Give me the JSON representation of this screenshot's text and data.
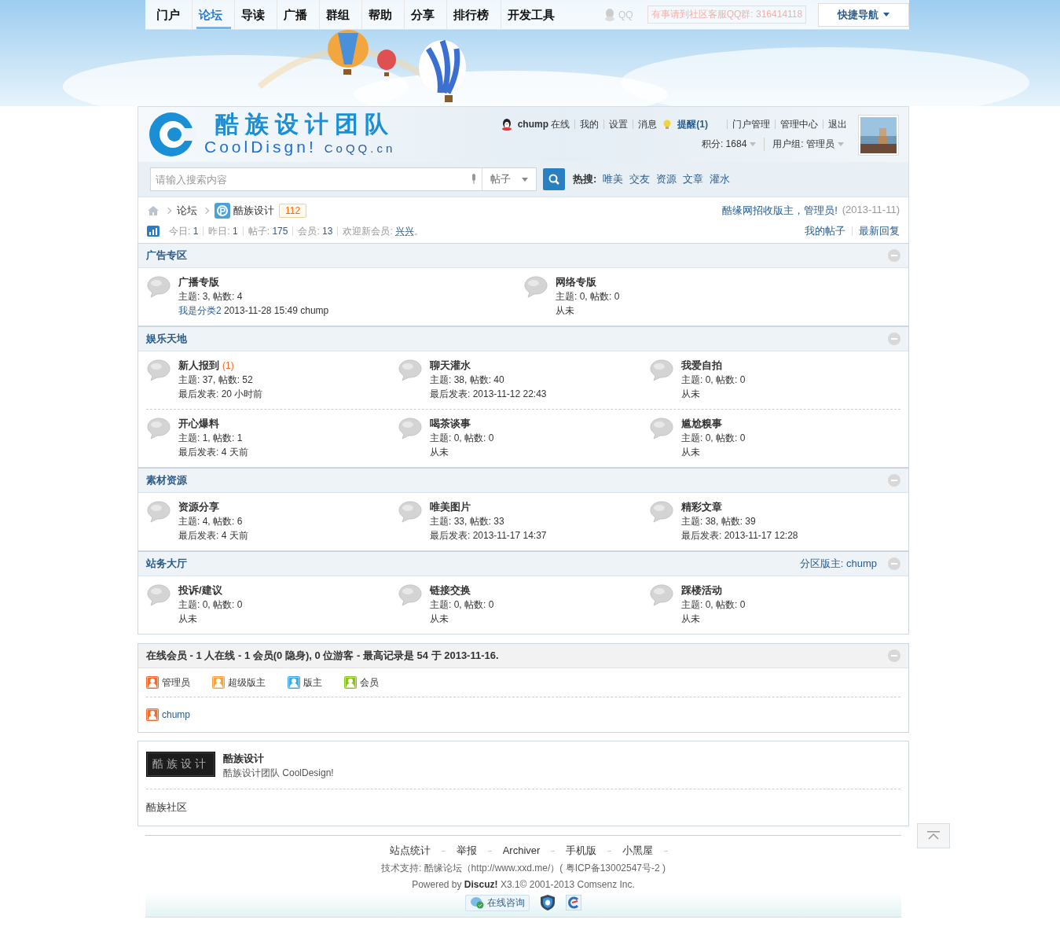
{
  "nav": {
    "items": [
      {
        "label": "门户",
        "selected": false
      },
      {
        "label": "论坛",
        "selected": true
      },
      {
        "label": "导读",
        "selected": false
      },
      {
        "label": "广播",
        "selected": false
      },
      {
        "label": "群组",
        "selected": false
      },
      {
        "label": "帮助",
        "selected": false
      },
      {
        "label": "分享",
        "selected": false
      },
      {
        "label": "排行榜",
        "selected": false
      },
      {
        "label": "开发工具",
        "selected": false
      }
    ],
    "qq": "QQ",
    "qq_group": "有事请到社区客服QQ群: 316414118",
    "quick_nav": "快捷导航"
  },
  "header": {
    "logo_title": "酷族设计团队",
    "logo_sub": "CoolDisgn!",
    "logo_site": "CoQQ.cn",
    "user": {
      "name": "chump",
      "status": "在线",
      "links": [
        "我的",
        "设置",
        "消息"
      ],
      "reminder": "提醒(1)",
      "admin_links": [
        "门户管理",
        "管理中心",
        "退出"
      ],
      "points": "积分: 1684",
      "group": "用户组: 管理员"
    }
  },
  "search": {
    "placeholder": "请输入搜索内容",
    "type": "帖子",
    "hot_label": "热搜:",
    "hot": [
      "唯美",
      "交友",
      "资源",
      "文章",
      "灌水"
    ]
  },
  "breadcrumb": {
    "items": [
      "论坛",
      "酷族设计"
    ],
    "count": "112",
    "notice": "酷缘网招收版主，管理员!",
    "notice_date": "(2013-11-11)"
  },
  "stats": {
    "items": [
      {
        "label": "今日:",
        "value": "1"
      },
      {
        "label": "昨日:",
        "value": "1"
      },
      {
        "label": "帖子:",
        "value": "175"
      },
      {
        "label": "会员:",
        "value": "13"
      }
    ],
    "welcome": "欢迎新会员:",
    "new_member": "兴兴",
    "welcome_end": "。",
    "links": [
      "我的帖子",
      "最新回复"
    ]
  },
  "categories": [
    {
      "title": "广告专区",
      "expanded": true,
      "forums": [
        {
          "name": "广播专版",
          "stats": "主题: 3, 帖数: 4",
          "last": {
            "thread": "我是分类2",
            "text": "2013-11-28 15:49 chump"
          }
        },
        {
          "name": "网络专版",
          "stats": "主题: 0, 帖数: 0",
          "last": {
            "text": "从未"
          }
        }
      ]
    },
    {
      "title": "娱乐天地",
      "expanded": true,
      "forums": [
        {
          "name": "新人报到",
          "today": "(1)",
          "stats": "主题: 37, 帖数: 52",
          "last": {
            "text": "最后发表: 20 小时前"
          }
        },
        {
          "name": "聊天灌水",
          "stats": "主题: 38, 帖数: 40",
          "last": {
            "text": "最后发表: 2013-11-12 22:43"
          }
        },
        {
          "name": "我爱自拍",
          "stats": "主题: 0, 帖数: 0",
          "last": {
            "text": "从未"
          }
        },
        {
          "name": "开心爆料",
          "stats": "主题: 1, 帖数: 1",
          "last": {
            "text": "最后发表: 4 天前"
          }
        },
        {
          "name": "喝茶谈事",
          "stats": "主题: 0, 帖数: 0",
          "last": {
            "text": "从未"
          }
        },
        {
          "name": "尴尬糗事",
          "stats": "主题: 0, 帖数: 0",
          "last": {
            "text": "从未"
          }
        }
      ]
    },
    {
      "title": "素材资源",
      "expanded": true,
      "forums": [
        {
          "name": "资源分享",
          "stats": "主题: 4, 帖数: 6",
          "last": {
            "text": "最后发表: 4 天前"
          }
        },
        {
          "name": "唯美图片",
          "stats": "主题: 33, 帖数: 33",
          "last": {
            "text": "最后发表: 2013-11-17 14:37"
          }
        },
        {
          "name": "精彩文章",
          "stats": "主题: 38, 帖数: 39",
          "last": {
            "text": "最后发表: 2013-11-17 12:28"
          }
        }
      ]
    },
    {
      "title": "站务大厅",
      "moderator": "分区版主: chump",
      "expanded": true,
      "forums": [
        {
          "name": "投诉/建议",
          "stats": "主题: 0, 帖数: 0",
          "last": {
            "text": "从未"
          }
        },
        {
          "name": "链接交换",
          "stats": "主题: 0, 帖数: 0",
          "last": {
            "text": "从未"
          }
        },
        {
          "name": "踩楼活动",
          "stats": "主题: 0, 帖数: 0",
          "last": {
            "text": "从未"
          }
        }
      ]
    }
  ],
  "online": {
    "title": "在线会员 - 1 人在线 - 1 会员(0 隐身), 0 位游客 - 最高记录是 54 于 2013-11-16.",
    "expanded": true,
    "legend": [
      {
        "label": "管理员",
        "color": "#f26c2e"
      },
      {
        "label": "超级版主",
        "color": "#f0a540"
      },
      {
        "label": "版主",
        "color": "#3fa9e0"
      },
      {
        "label": "会员",
        "color": "#8cc21f"
      }
    ],
    "members": [
      {
        "name": "chump",
        "color": "#f26c2e"
      }
    ]
  },
  "friend_links": {
    "logo_text": "酷族设计",
    "name": "酷族设计",
    "desc": "酷族设计团队 CoolDesign!",
    "text_links": [
      "酷族社区"
    ]
  },
  "footer": {
    "links": [
      "站点统计",
      "举报",
      "Archiver",
      "手机版",
      "小黑屋"
    ],
    "support": "技术支持: 酷缘论坛（http://www.xxd.me/）( 粤ICP备13002547号-2 )",
    "powered": "Powered by **Discuz!** X3.1© 2001-2013 Comsenz Inc.",
    "consult": "在线咨询"
  }
}
